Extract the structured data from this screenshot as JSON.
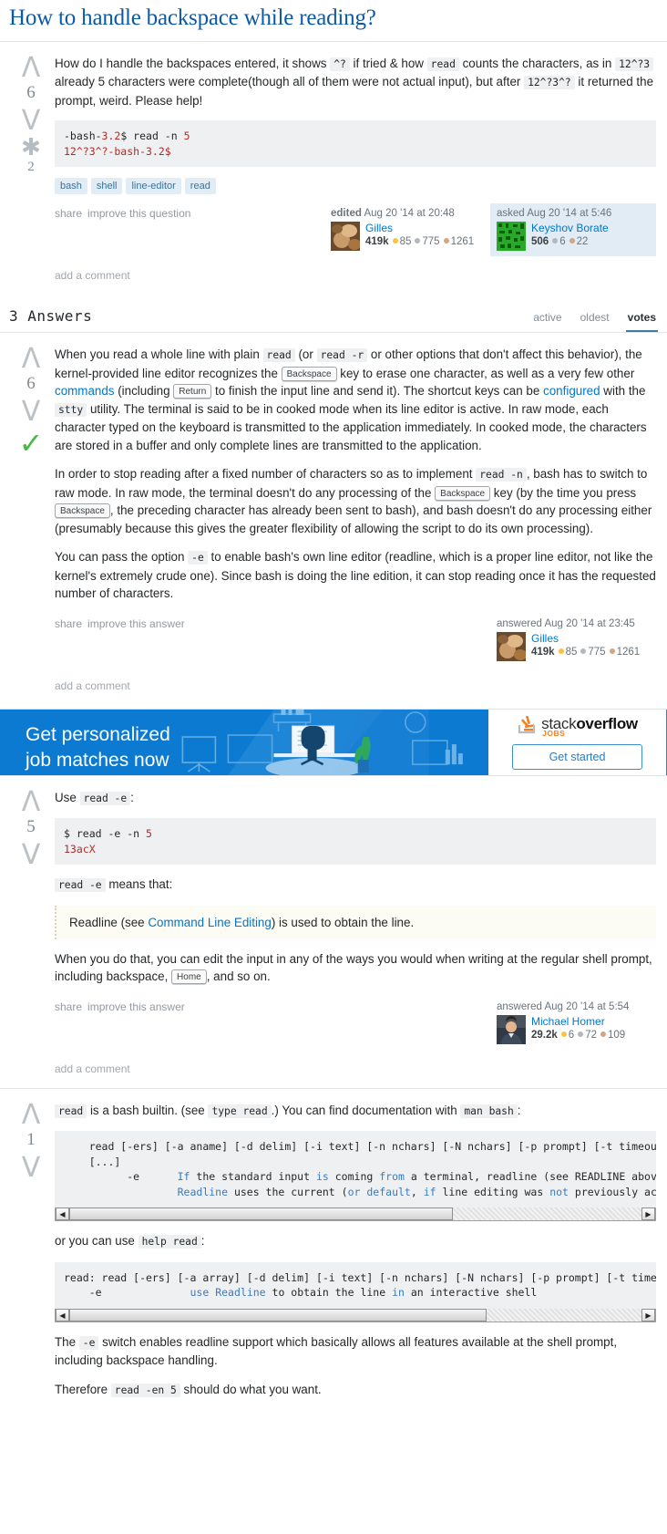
{
  "question": {
    "title": "How to handle backspace while reading?",
    "votes": "6",
    "favorites": "2",
    "body_parts": [
      "How do I handle the backspaces entered, it shows ",
      "^?",
      " if tried & how ",
      "read",
      " counts the characters, as in ",
      "12^?3",
      " already 5 characters were complete(though all of them were not actual input), but after ",
      "12^?3^?",
      " it returned the prompt, weird. Please help!"
    ],
    "code": "-bash-3.2$ read -n 5\n12^?3^?-bash-3.2$",
    "code_line1_pre": "-bash-",
    "code_line1_ver": "3.2",
    "code_line1_post": "$ read -n ",
    "code_line1_num": "5",
    "code_line2": "12^?3^?-bash-3.2$",
    "tags": [
      "bash",
      "shell",
      "line-editor",
      "read"
    ],
    "share_label": "share",
    "improve_label": "improve this question",
    "add_comment": "add a comment",
    "editor": {
      "action": "edited",
      "time": "Aug 20 '14 at 20:48",
      "name": "Gilles",
      "rep": "419k",
      "gold": "85",
      "silver": "775",
      "bronze": "1261"
    },
    "asker": {
      "action": "asked",
      "time": "Aug 20 '14 at 5:46",
      "name": "Keyshov Borate",
      "rep": "506",
      "silver": "6",
      "bronze": "22"
    }
  },
  "answers_header": {
    "count_label": "3 Answers",
    "tabs": [
      {
        "label": "active",
        "active": false
      },
      {
        "label": "oldest",
        "active": false
      },
      {
        "label": "votes",
        "active": true
      }
    ]
  },
  "answer1": {
    "votes": "6",
    "accepted": true,
    "p1": {
      "t1": "When you read a whole line with plain ",
      "c1": "read",
      "t2": " (or ",
      "c2": "read -r",
      "t3": " or other options that don't affect this behavior), the kernel-provided line editor recognizes the ",
      "k1": "Backspace",
      "t4": " key to erase one character, as well as a very few other ",
      "a1": "commands",
      "t5": " (including ",
      "k2": "Return",
      "t6": " to finish the input line and send it). The shortcut keys can be ",
      "a2": "configured",
      "t7": " with the ",
      "c3": "stty",
      "t8": " utility. The terminal is said to be in cooked mode when its line editor is active. In raw mode, each character typed on the keyboard is transmitted to the application immediately. In cooked mode, the characters are stored in a buffer and only complete lines are transmitted to the application."
    },
    "p2": {
      "t1": "In order to stop reading after a fixed number of characters so as to implement ",
      "c1": "read -n",
      "t2": ", bash has to switch to raw mode. In raw mode, the terminal doesn't do any processing of the ",
      "k1": "Backspace",
      "t3": " key (by the time you press ",
      "k2": "Backspace",
      "t4": ", the preceding character has already been sent to bash), and bash doesn't do any processing either (presumably because this gives the greater flexibility of allowing the script to do its own processing)."
    },
    "p3": {
      "t1": "You can pass the option ",
      "c1": "-e",
      "t2": " to enable bash's own line editor (readline, which is a proper line editor, not like the kernel's extremely crude one). Since bash is doing the line edition, it can stop reading once it has the requested number of characters."
    },
    "share_label": "share",
    "improve_label": "improve this answer",
    "add_comment": "add a comment",
    "author": {
      "action": "answered",
      "time": "Aug 20 '14 at 23:45",
      "name": "Gilles",
      "rep": "419k",
      "gold": "85",
      "silver": "775",
      "bronze": "1261"
    }
  },
  "ad": {
    "headline_line1": "Get personalized",
    "headline_line2": "job matches now",
    "logo_stack": "stack",
    "logo_overflow": "overflow",
    "logo_jobs": "JOBS",
    "button": "Get started"
  },
  "answer2": {
    "votes": "5",
    "p1": {
      "t1": "Use ",
      "c1": "read -e",
      "t2": ":"
    },
    "code_prompt": "$ read -e -n ",
    "code_num": "5",
    "code_out": "13acX",
    "p2": {
      "c1": "read -e",
      "t1": " means that:"
    },
    "quote": {
      "t1": "Readline (see ",
      "a1": "Command Line Editing",
      "t2": ") is used to obtain the line."
    },
    "p3": {
      "t1": "When you do that, you can edit the input in any of the ways you would when writing at the regular shell prompt, including backspace, ",
      "k1": "Home",
      "t2": ", and so on."
    },
    "share_label": "share",
    "improve_label": "improve this answer",
    "add_comment": "add a comment",
    "author": {
      "action": "answered",
      "time": "Aug 20 '14 at 5:54",
      "name": "Michael Homer",
      "rep": "29.2k",
      "gold": "6",
      "silver": "72",
      "bronze": "109"
    }
  },
  "answer3": {
    "votes": "1",
    "p1": {
      "c1": "read",
      "t1": " is a bash builtin. (see ",
      "c2": "type read",
      "t2": ".) You can find documentation with ",
      "c3": "man bash",
      "t3": ":"
    },
    "code1_line1": "    read [-ers] [-a aname] [-d delim] [-i text] [-n nchars] [-N nchars] [-p prompt] [-t timeout",
    "code1_line2": "    [...]",
    "code1_line3_pre": "          -e      ",
    "code1_line3_kw": "If",
    "code1_line3_a": " the standard input ",
    "code1_line3_kw2": "is",
    "code1_line3_b": " coming ",
    "code1_line3_kw3": "from",
    "code1_line3_c": " a terminal, readline (see READLINE above",
    "code1_line4_pre": "                  ",
    "code1_line4_kw": "Readline",
    "code1_line4_a": " uses the current (",
    "code1_line4_kw2": "or",
    "code1_line4_b": " ",
    "code1_line4_kw3": "default",
    "code1_line4_c": ", ",
    "code1_line4_kw4": "if",
    "code1_line4_d": " line editing was ",
    "code1_line4_kw5": "not",
    "code1_line4_e": " previously act",
    "p2": {
      "t1": "or you can use ",
      "c1": "help read",
      "t2": ":"
    },
    "code2_line1": "read: read [-ers] [-a array] [-d delim] [-i text] [-n nchars] [-N nchars] [-p prompt] [-t time",
    "code2_line2_pre": "    -e              ",
    "code2_line2_kw": "use",
    "code2_line2_a": " ",
    "code2_line2_kw2": "Readline",
    "code2_line2_b": " to obtain the line ",
    "code2_line2_kw3": "in",
    "code2_line2_c": " an interactive shell",
    "p3": {
      "t1": "The ",
      "c1": "-e",
      "t2": " switch enables readline support which basically allows all features available at the shell prompt, including backspace handling."
    },
    "p4": {
      "t1": "Therefore ",
      "c1": "read -en 5",
      "t2": " should do what you want."
    }
  }
}
